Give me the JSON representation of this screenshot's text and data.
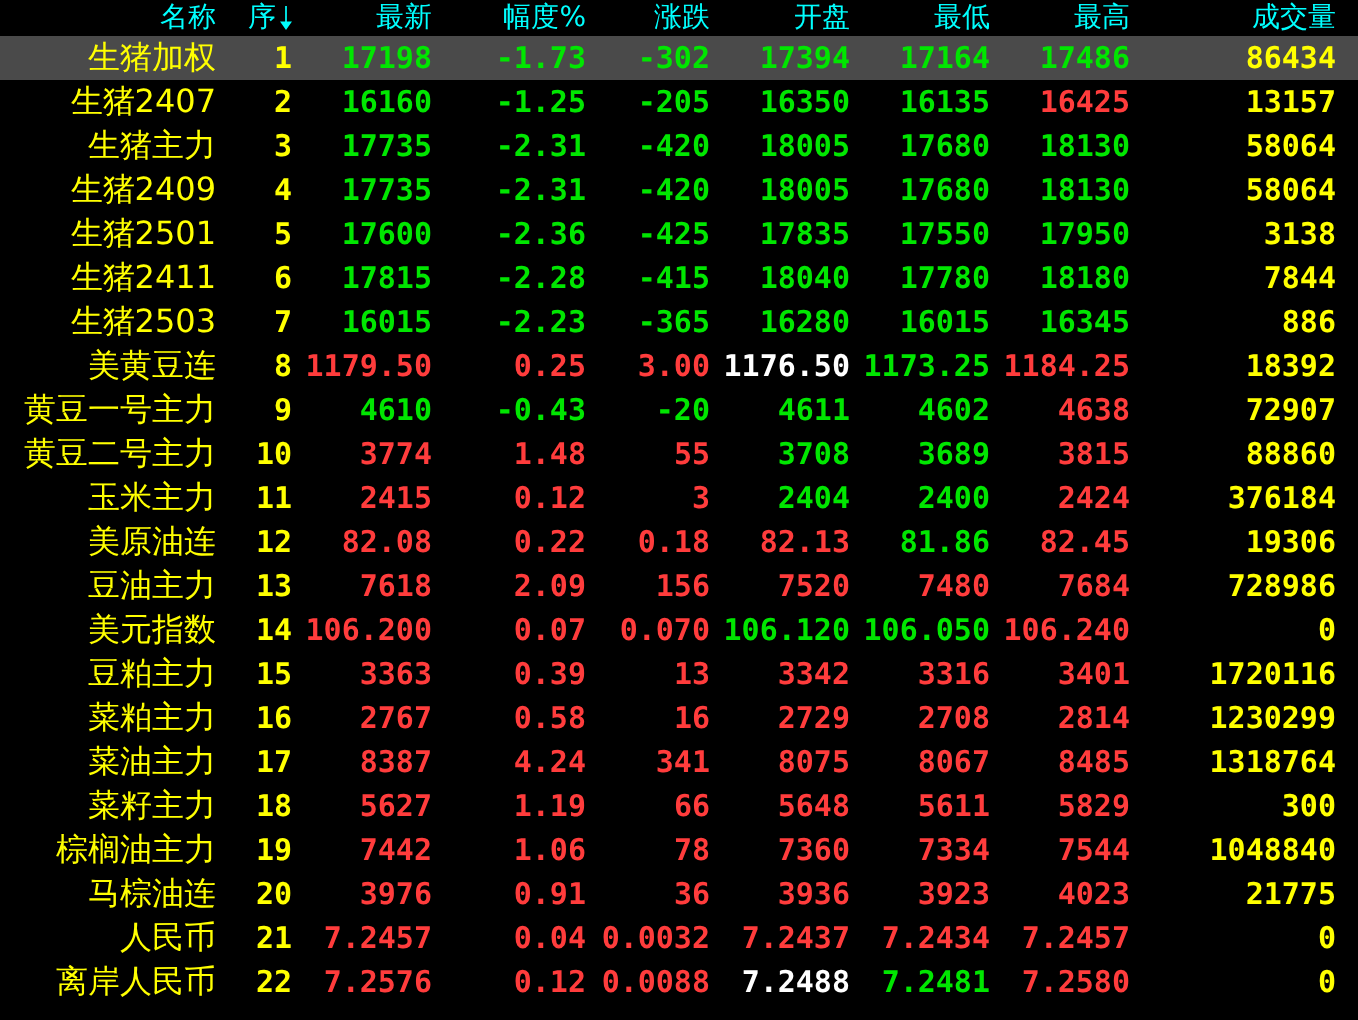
{
  "table": {
    "columns": [
      {
        "label": "名称",
        "sorted": false
      },
      {
        "label": "序",
        "sorted": true
      },
      {
        "label": "最新",
        "sorted": false
      },
      {
        "label": "幅度%",
        "sorted": false
      },
      {
        "label": "涨跌",
        "sorted": false
      },
      {
        "label": "开盘",
        "sorted": false
      },
      {
        "label": "最低",
        "sorted": false
      },
      {
        "label": "最高",
        "sorted": false
      },
      {
        "label": "成交量",
        "sorted": false
      }
    ],
    "rows": [
      {
        "selected": true,
        "name": "生猪加权",
        "index": "1",
        "latest": {
          "text": "17198",
          "color": "#00e600"
        },
        "percent": {
          "text": "-1.73",
          "color": "#00e600"
        },
        "change": {
          "text": "-302",
          "color": "#00e600"
        },
        "open": {
          "text": "17394",
          "color": "#00e600"
        },
        "low": {
          "text": "17164",
          "color": "#00e600"
        },
        "high": {
          "text": "17486",
          "color": "#00e600"
        },
        "volume": "86434"
      },
      {
        "selected": false,
        "name": "生猪2407",
        "index": "2",
        "latest": {
          "text": "16160",
          "color": "#00e600"
        },
        "percent": {
          "text": "-1.25",
          "color": "#00e600"
        },
        "change": {
          "text": "-205",
          "color": "#00e600"
        },
        "open": {
          "text": "16350",
          "color": "#00e600"
        },
        "low": {
          "text": "16135",
          "color": "#00e600"
        },
        "high": {
          "text": "16425",
          "color": "#ff3c3c"
        },
        "volume": "13157"
      },
      {
        "selected": false,
        "name": "生猪主力",
        "index": "3",
        "latest": {
          "text": "17735",
          "color": "#00e600"
        },
        "percent": {
          "text": "-2.31",
          "color": "#00e600"
        },
        "change": {
          "text": "-420",
          "color": "#00e600"
        },
        "open": {
          "text": "18005",
          "color": "#00e600"
        },
        "low": {
          "text": "17680",
          "color": "#00e600"
        },
        "high": {
          "text": "18130",
          "color": "#00e600"
        },
        "volume": "58064"
      },
      {
        "selected": false,
        "name": "生猪2409",
        "index": "4",
        "latest": {
          "text": "17735",
          "color": "#00e600"
        },
        "percent": {
          "text": "-2.31",
          "color": "#00e600"
        },
        "change": {
          "text": "-420",
          "color": "#00e600"
        },
        "open": {
          "text": "18005",
          "color": "#00e600"
        },
        "low": {
          "text": "17680",
          "color": "#00e600"
        },
        "high": {
          "text": "18130",
          "color": "#00e600"
        },
        "volume": "58064"
      },
      {
        "selected": false,
        "name": "生猪2501",
        "index": "5",
        "latest": {
          "text": "17600",
          "color": "#00e600"
        },
        "percent": {
          "text": "-2.36",
          "color": "#00e600"
        },
        "change": {
          "text": "-425",
          "color": "#00e600"
        },
        "open": {
          "text": "17835",
          "color": "#00e600"
        },
        "low": {
          "text": "17550",
          "color": "#00e600"
        },
        "high": {
          "text": "17950",
          "color": "#00e600"
        },
        "volume": "3138"
      },
      {
        "selected": false,
        "name": "生猪2411",
        "index": "6",
        "latest": {
          "text": "17815",
          "color": "#00e600"
        },
        "percent": {
          "text": "-2.28",
          "color": "#00e600"
        },
        "change": {
          "text": "-415",
          "color": "#00e600"
        },
        "open": {
          "text": "18040",
          "color": "#00e600"
        },
        "low": {
          "text": "17780",
          "color": "#00e600"
        },
        "high": {
          "text": "18180",
          "color": "#00e600"
        },
        "volume": "7844"
      },
      {
        "selected": false,
        "name": "生猪2503",
        "index": "7",
        "latest": {
          "text": "16015",
          "color": "#00e600"
        },
        "percent": {
          "text": "-2.23",
          "color": "#00e600"
        },
        "change": {
          "text": "-365",
          "color": "#00e600"
        },
        "open": {
          "text": "16280",
          "color": "#00e600"
        },
        "low": {
          "text": "16015",
          "color": "#00e600"
        },
        "high": {
          "text": "16345",
          "color": "#00e600"
        },
        "volume": "886"
      },
      {
        "selected": false,
        "name": "美黄豆连",
        "index": "8",
        "latest": {
          "text": "1179.50",
          "color": "#ff3c3c"
        },
        "percent": {
          "text": "0.25",
          "color": "#ff3c3c"
        },
        "change": {
          "text": "3.00",
          "color": "#ff3c3c"
        },
        "open": {
          "text": "1176.50",
          "color": "#ffffff"
        },
        "low": {
          "text": "1173.25",
          "color": "#00e600"
        },
        "high": {
          "text": "1184.25",
          "color": "#ff3c3c"
        },
        "volume": "18392"
      },
      {
        "selected": false,
        "name": "黄豆一号主力",
        "index": "9",
        "latest": {
          "text": "4610",
          "color": "#00e600"
        },
        "percent": {
          "text": "-0.43",
          "color": "#00e600"
        },
        "change": {
          "text": "-20",
          "color": "#00e600"
        },
        "open": {
          "text": "4611",
          "color": "#00e600"
        },
        "low": {
          "text": "4602",
          "color": "#00e600"
        },
        "high": {
          "text": "4638",
          "color": "#ff3c3c"
        },
        "volume": "72907"
      },
      {
        "selected": false,
        "name": "黄豆二号主力",
        "index": "10",
        "latest": {
          "text": "3774",
          "color": "#ff3c3c"
        },
        "percent": {
          "text": "1.48",
          "color": "#ff3c3c"
        },
        "change": {
          "text": "55",
          "color": "#ff3c3c"
        },
        "open": {
          "text": "3708",
          "color": "#00e600"
        },
        "low": {
          "text": "3689",
          "color": "#00e600"
        },
        "high": {
          "text": "3815",
          "color": "#ff3c3c"
        },
        "volume": "88860"
      },
      {
        "selected": false,
        "name": "玉米主力",
        "index": "11",
        "latest": {
          "text": "2415",
          "color": "#ff3c3c"
        },
        "percent": {
          "text": "0.12",
          "color": "#ff3c3c"
        },
        "change": {
          "text": "3",
          "color": "#ff3c3c"
        },
        "open": {
          "text": "2404",
          "color": "#00e600"
        },
        "low": {
          "text": "2400",
          "color": "#00e600"
        },
        "high": {
          "text": "2424",
          "color": "#ff3c3c"
        },
        "volume": "376184"
      },
      {
        "selected": false,
        "name": "美原油连",
        "index": "12",
        "latest": {
          "text": "82.08",
          "color": "#ff3c3c"
        },
        "percent": {
          "text": "0.22",
          "color": "#ff3c3c"
        },
        "change": {
          "text": "0.18",
          "color": "#ff3c3c"
        },
        "open": {
          "text": "82.13",
          "color": "#ff3c3c"
        },
        "low": {
          "text": "81.86",
          "color": "#00e600"
        },
        "high": {
          "text": "82.45",
          "color": "#ff3c3c"
        },
        "volume": "19306"
      },
      {
        "selected": false,
        "name": "豆油主力",
        "index": "13",
        "latest": {
          "text": "7618",
          "color": "#ff3c3c"
        },
        "percent": {
          "text": "2.09",
          "color": "#ff3c3c"
        },
        "change": {
          "text": "156",
          "color": "#ff3c3c"
        },
        "open": {
          "text": "7520",
          "color": "#ff3c3c"
        },
        "low": {
          "text": "7480",
          "color": "#ff3c3c"
        },
        "high": {
          "text": "7684",
          "color": "#ff3c3c"
        },
        "volume": "728986"
      },
      {
        "selected": false,
        "name": "美元指数",
        "index": "14",
        "latest": {
          "text": "106.200",
          "color": "#ff3c3c"
        },
        "percent": {
          "text": "0.07",
          "color": "#ff3c3c"
        },
        "change": {
          "text": "0.070",
          "color": "#ff3c3c"
        },
        "open": {
          "text": "106.120",
          "color": "#00e600"
        },
        "low": {
          "text": "106.050",
          "color": "#00e600"
        },
        "high": {
          "text": "106.240",
          "color": "#ff3c3c"
        },
        "volume": "0"
      },
      {
        "selected": false,
        "name": "豆粕主力",
        "index": "15",
        "latest": {
          "text": "3363",
          "color": "#ff3c3c"
        },
        "percent": {
          "text": "0.39",
          "color": "#ff3c3c"
        },
        "change": {
          "text": "13",
          "color": "#ff3c3c"
        },
        "open": {
          "text": "3342",
          "color": "#ff3c3c"
        },
        "low": {
          "text": "3316",
          "color": "#ff3c3c"
        },
        "high": {
          "text": "3401",
          "color": "#ff3c3c"
        },
        "volume": "1720116"
      },
      {
        "selected": false,
        "name": "菜粕主力",
        "index": "16",
        "latest": {
          "text": "2767",
          "color": "#ff3c3c"
        },
        "percent": {
          "text": "0.58",
          "color": "#ff3c3c"
        },
        "change": {
          "text": "16",
          "color": "#ff3c3c"
        },
        "open": {
          "text": "2729",
          "color": "#ff3c3c"
        },
        "low": {
          "text": "2708",
          "color": "#ff3c3c"
        },
        "high": {
          "text": "2814",
          "color": "#ff3c3c"
        },
        "volume": "1230299"
      },
      {
        "selected": false,
        "name": "菜油主力",
        "index": "17",
        "latest": {
          "text": "8387",
          "color": "#ff3c3c"
        },
        "percent": {
          "text": "4.24",
          "color": "#ff3c3c"
        },
        "change": {
          "text": "341",
          "color": "#ff3c3c"
        },
        "open": {
          "text": "8075",
          "color": "#ff3c3c"
        },
        "low": {
          "text": "8067",
          "color": "#ff3c3c"
        },
        "high": {
          "text": "8485",
          "color": "#ff3c3c"
        },
        "volume": "1318764"
      },
      {
        "selected": false,
        "name": "菜籽主力",
        "index": "18",
        "latest": {
          "text": "5627",
          "color": "#ff3c3c"
        },
        "percent": {
          "text": "1.19",
          "color": "#ff3c3c"
        },
        "change": {
          "text": "66",
          "color": "#ff3c3c"
        },
        "open": {
          "text": "5648",
          "color": "#ff3c3c"
        },
        "low": {
          "text": "5611",
          "color": "#ff3c3c"
        },
        "high": {
          "text": "5829",
          "color": "#ff3c3c"
        },
        "volume": "300"
      },
      {
        "selected": false,
        "name": "棕榈油主力",
        "index": "19",
        "latest": {
          "text": "7442",
          "color": "#ff3c3c"
        },
        "percent": {
          "text": "1.06",
          "color": "#ff3c3c"
        },
        "change": {
          "text": "78",
          "color": "#ff3c3c"
        },
        "open": {
          "text": "7360",
          "color": "#ff3c3c"
        },
        "low": {
          "text": "7334",
          "color": "#ff3c3c"
        },
        "high": {
          "text": "7544",
          "color": "#ff3c3c"
        },
        "volume": "1048840"
      },
      {
        "selected": false,
        "name": "马棕油连",
        "index": "20",
        "latest": {
          "text": "3976",
          "color": "#ff3c3c"
        },
        "percent": {
          "text": "0.91",
          "color": "#ff3c3c"
        },
        "change": {
          "text": "36",
          "color": "#ff3c3c"
        },
        "open": {
          "text": "3936",
          "color": "#ff3c3c"
        },
        "low": {
          "text": "3923",
          "color": "#ff3c3c"
        },
        "high": {
          "text": "4023",
          "color": "#ff3c3c"
        },
        "volume": "21775"
      },
      {
        "selected": false,
        "name": "人民币",
        "index": "21",
        "latest": {
          "text": "7.2457",
          "color": "#ff3c3c"
        },
        "percent": {
          "text": "0.04",
          "color": "#ff3c3c"
        },
        "change": {
          "text": "0.0032",
          "color": "#ff3c3c"
        },
        "open": {
          "text": "7.2437",
          "color": "#ff3c3c"
        },
        "low": {
          "text": "7.2434",
          "color": "#ff3c3c"
        },
        "high": {
          "text": "7.2457",
          "color": "#ff3c3c"
        },
        "volume": "0"
      },
      {
        "selected": false,
        "name": "离岸人民币",
        "index": "22",
        "latest": {
          "text": "7.2576",
          "color": "#ff3c3c"
        },
        "percent": {
          "text": "0.12",
          "color": "#ff3c3c"
        },
        "change": {
          "text": "0.0088",
          "color": "#ff3c3c"
        },
        "open": {
          "text": "7.2488",
          "color": "#ffffff"
        },
        "low": {
          "text": "7.2481",
          "color": "#00e600"
        },
        "high": {
          "text": "7.2580",
          "color": "#ff3c3c"
        },
        "volume": "0"
      }
    ]
  }
}
